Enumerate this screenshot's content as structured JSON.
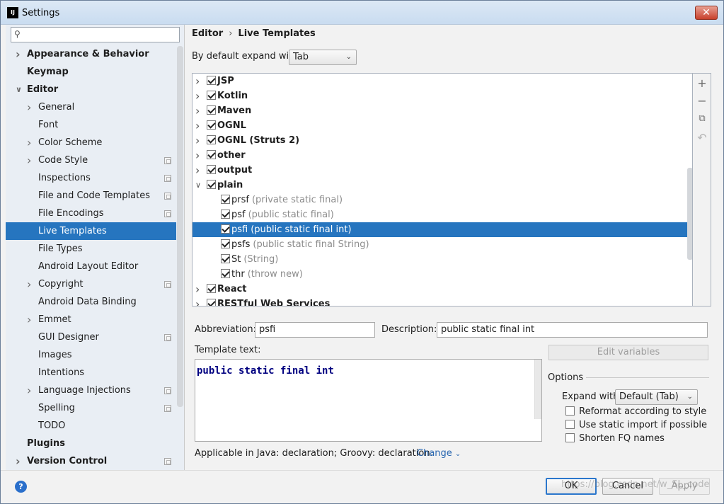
{
  "window": {
    "title": "Settings",
    "icon_text": "IJ",
    "close_label": "✕"
  },
  "search": {
    "placeholder": ""
  },
  "sidebar": {
    "items": [
      {
        "label": "Appearance & Behavior",
        "level": 0,
        "bold": true,
        "expander": "collapsed",
        "copy": false
      },
      {
        "label": "Keymap",
        "level": 0,
        "bold": true,
        "expander": "none",
        "copy": false
      },
      {
        "label": "Editor",
        "level": 0,
        "bold": true,
        "expander": "expanded",
        "copy": false
      },
      {
        "label": "General",
        "level": 1,
        "bold": false,
        "expander": "collapsed",
        "copy": false
      },
      {
        "label": "Font",
        "level": 1,
        "bold": false,
        "expander": "none",
        "copy": false
      },
      {
        "label": "Color Scheme",
        "level": 1,
        "bold": false,
        "expander": "collapsed",
        "copy": false
      },
      {
        "label": "Code Style",
        "level": 1,
        "bold": false,
        "expander": "collapsed",
        "copy": true
      },
      {
        "label": "Inspections",
        "level": 1,
        "bold": false,
        "expander": "none",
        "copy": true
      },
      {
        "label": "File and Code Templates",
        "level": 1,
        "bold": false,
        "expander": "none",
        "copy": true
      },
      {
        "label": "File Encodings",
        "level": 1,
        "bold": false,
        "expander": "none",
        "copy": true
      },
      {
        "label": "Live Templates",
        "level": 1,
        "bold": false,
        "expander": "none",
        "copy": false,
        "selected": true
      },
      {
        "label": "File Types",
        "level": 1,
        "bold": false,
        "expander": "none",
        "copy": false
      },
      {
        "label": "Android Layout Editor",
        "level": 1,
        "bold": false,
        "expander": "none",
        "copy": false
      },
      {
        "label": "Copyright",
        "level": 1,
        "bold": false,
        "expander": "collapsed",
        "copy": true
      },
      {
        "label": "Android Data Binding",
        "level": 1,
        "bold": false,
        "expander": "none",
        "copy": false
      },
      {
        "label": "Emmet",
        "level": 1,
        "bold": false,
        "expander": "collapsed",
        "copy": false
      },
      {
        "label": "GUI Designer",
        "level": 1,
        "bold": false,
        "expander": "none",
        "copy": true
      },
      {
        "label": "Images",
        "level": 1,
        "bold": false,
        "expander": "none",
        "copy": false
      },
      {
        "label": "Intentions",
        "level": 1,
        "bold": false,
        "expander": "none",
        "copy": false
      },
      {
        "label": "Language Injections",
        "level": 1,
        "bold": false,
        "expander": "collapsed",
        "copy": true
      },
      {
        "label": "Spelling",
        "level": 1,
        "bold": false,
        "expander": "none",
        "copy": true
      },
      {
        "label": "TODO",
        "level": 1,
        "bold": false,
        "expander": "none",
        "copy": false
      },
      {
        "label": "Plugins",
        "level": 0,
        "bold": true,
        "expander": "none",
        "copy": false
      },
      {
        "label": "Version Control",
        "level": 0,
        "bold": true,
        "expander": "collapsed",
        "copy": true
      }
    ]
  },
  "breadcrumb": {
    "parent": "Editor",
    "separator": "›",
    "current": "Live Templates"
  },
  "expand_default": {
    "label": "By default expand with",
    "value": "Tab"
  },
  "templates": [
    {
      "name": "JSP",
      "desc": "",
      "group": true,
      "expander": "collapsed",
      "checked": true
    },
    {
      "name": "Kotlin",
      "desc": "",
      "group": true,
      "expander": "collapsed",
      "checked": true
    },
    {
      "name": "Maven",
      "desc": "",
      "group": true,
      "expander": "collapsed",
      "checked": true
    },
    {
      "name": "OGNL",
      "desc": "",
      "group": true,
      "expander": "collapsed",
      "checked": true
    },
    {
      "name": "OGNL (Struts 2)",
      "desc": "",
      "group": true,
      "expander": "collapsed",
      "checked": true
    },
    {
      "name": "other",
      "desc": "",
      "group": true,
      "expander": "collapsed",
      "checked": true
    },
    {
      "name": "output",
      "desc": "",
      "group": true,
      "expander": "collapsed",
      "checked": true
    },
    {
      "name": "plain",
      "desc": "",
      "group": true,
      "expander": "expanded",
      "checked": true
    },
    {
      "name": "prsf",
      "desc": "(private static final)",
      "group": false,
      "checked": true
    },
    {
      "name": "psf",
      "desc": "(public static final)",
      "group": false,
      "checked": true
    },
    {
      "name": "psfi",
      "desc": "(public static final int)",
      "group": false,
      "checked": true,
      "selected": true
    },
    {
      "name": "psfs",
      "desc": "(public static final String)",
      "group": false,
      "checked": true
    },
    {
      "name": "St",
      "desc": "(String)",
      "group": false,
      "checked": true
    },
    {
      "name": "thr",
      "desc": "(throw new)",
      "group": false,
      "checked": true
    },
    {
      "name": "React",
      "desc": "",
      "group": true,
      "expander": "collapsed",
      "checked": true
    },
    {
      "name": "RESTful Web Services",
      "desc": "",
      "group": true,
      "expander": "collapsed",
      "checked": true
    }
  ],
  "toolbar": {
    "add": "+",
    "remove": "−",
    "copy": "⧉",
    "revert": "↶"
  },
  "editor": {
    "abbreviation_label": "Abbreviation:",
    "abbreviation_value": "psfi",
    "description_label": "Description:",
    "description_value": "public static final int",
    "template_text_label": "Template text:",
    "template_text": "public static final int",
    "edit_variables": "Edit variables",
    "applicable_text": "Applicable in Java: declaration; Groovy: declaration.",
    "change_link": "Change"
  },
  "options": {
    "legend": "Options",
    "expand_with_label": "Expand with",
    "expand_with_value": "Default (Tab)",
    "reformat": {
      "label": "Reformat according to style",
      "checked": false
    },
    "static_import": {
      "label": "Use static import if possible",
      "checked": false
    },
    "shorten_fq": {
      "label": "Shorten FQ names",
      "checked": false
    }
  },
  "buttons": {
    "help": "?",
    "ok": "OK",
    "cancel": "Cancel",
    "apply": "Apply"
  },
  "watermark": "https://blog.csdn.net/w_SL_code"
}
